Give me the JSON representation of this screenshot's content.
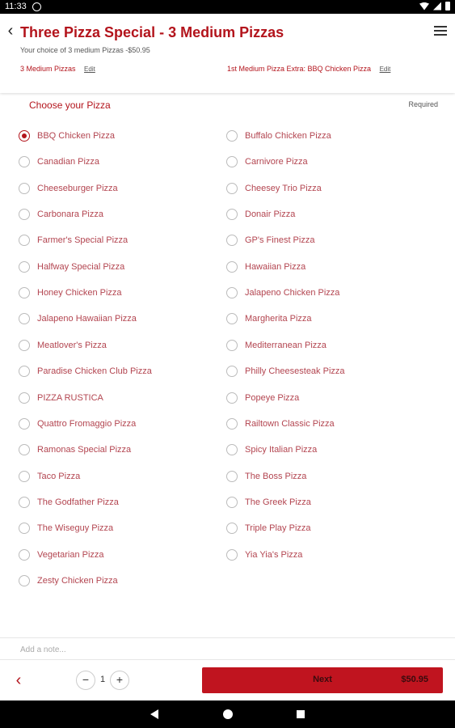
{
  "status_bar": {
    "time": "11:33"
  },
  "header": {
    "title": "Three Pizza Special - 3 Medium Pizzas",
    "subtitle": "Your choice of 3 medium Pizzas -$50.95",
    "selections": [
      {
        "label": "3 Medium Pizzas",
        "edit": "Edit"
      },
      {
        "label": "1st Medium Pizza Extra: BBQ Chicken Pizza",
        "edit": "Edit"
      }
    ]
  },
  "section": {
    "title": "Choose your Pizza",
    "required": "Required"
  },
  "pizzas": {
    "left": [
      {
        "label": "BBQ Chicken Pizza",
        "checked": true
      },
      {
        "label": "Canadian Pizza",
        "checked": false
      },
      {
        "label": "Cheeseburger Pizza",
        "checked": false
      },
      {
        "label": "Carbonara Pizza",
        "checked": false
      },
      {
        "label": "Farmer's Special Pizza",
        "checked": false
      },
      {
        "label": "Halfway Special Pizza",
        "checked": false
      },
      {
        "label": "Honey Chicken Pizza",
        "checked": false
      },
      {
        "label": "Jalapeno Hawaiian Pizza",
        "checked": false
      },
      {
        "label": "Meatlover's Pizza",
        "checked": false
      },
      {
        "label": "Paradise Chicken Club Pizza",
        "checked": false
      },
      {
        "label": "PIZZA RUSTICA",
        "checked": false
      },
      {
        "label": "Quattro Fromaggio Pizza",
        "checked": false
      },
      {
        "label": "Ramonas Special Pizza",
        "checked": false
      },
      {
        "label": "Taco Pizza",
        "checked": false
      },
      {
        "label": "The Godfather Pizza",
        "checked": false
      },
      {
        "label": "The Wiseguy Pizza",
        "checked": false
      },
      {
        "label": "Vegetarian Pizza",
        "checked": false
      },
      {
        "label": "Zesty Chicken Pizza",
        "checked": false
      }
    ],
    "right": [
      {
        "label": "Buffalo Chicken Pizza",
        "checked": false
      },
      {
        "label": "Carnivore Pizza",
        "checked": false
      },
      {
        "label": "Cheesey Trio Pizza",
        "checked": false
      },
      {
        "label": "Donair Pizza",
        "checked": false
      },
      {
        "label": "GP's Finest Pizza",
        "checked": false
      },
      {
        "label": "Hawaiian Pizza",
        "checked": false
      },
      {
        "label": "Jalapeno Chicken Pizza",
        "checked": false
      },
      {
        "label": "Margherita Pizza",
        "checked": false
      },
      {
        "label": "Mediterranean Pizza",
        "checked": false
      },
      {
        "label": "Philly Cheesesteak Pizza",
        "checked": false
      },
      {
        "label": "Popeye Pizza",
        "checked": false
      },
      {
        "label": "Railtown Classic Pizza",
        "checked": false
      },
      {
        "label": "Spicy Italian Pizza",
        "checked": false
      },
      {
        "label": "The Boss Pizza",
        "checked": false
      },
      {
        "label": "The Greek Pizza",
        "checked": false
      },
      {
        "label": "Triple Play Pizza",
        "checked": false
      },
      {
        "label": "Yia Yia's Pizza",
        "checked": false
      }
    ]
  },
  "note": {
    "placeholder": "Add a note..."
  },
  "footer": {
    "quantity": "1",
    "minus": "−",
    "plus": "+",
    "next_label": "Next",
    "price": "$50.95"
  },
  "colors": {
    "accent": "#b3141c",
    "button": "#c0141f"
  },
  "icons": {
    "header_back": "chevron-left-icon",
    "menu": "hamburger-menu-icon",
    "footer_back": "chevron-left-icon",
    "nav_back": "triangle-back-icon",
    "nav_home": "circle-home-icon",
    "nav_recent": "square-recent-icon"
  }
}
